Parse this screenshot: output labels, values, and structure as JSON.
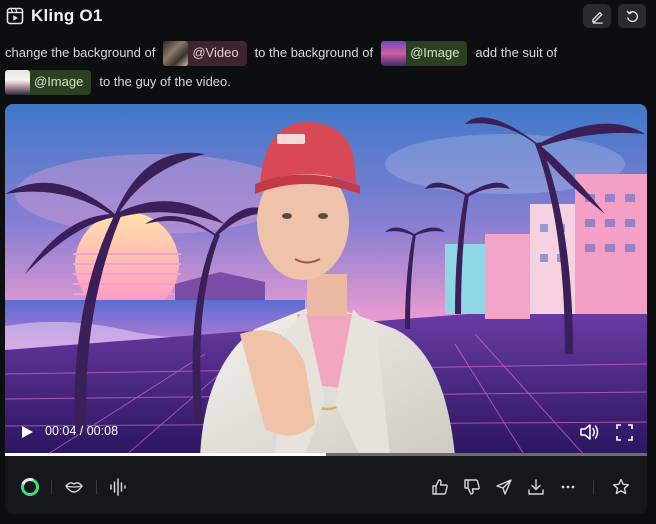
{
  "header": {
    "title": "Kling O1",
    "logo_icon": "film-icon",
    "edit_icon": "pencil-icon",
    "reset_icon": "undo-icon"
  },
  "prompt": {
    "text_1": "change the background of",
    "chip_video": "@Video",
    "text_2": "to the background of",
    "chip_image_1": "@Image",
    "text_3": "add the suit of",
    "chip_image_2": "@Image",
    "text_4": "to the guy of the video."
  },
  "player": {
    "current_time": "00:04",
    "separator": "/",
    "duration": "00:08",
    "progress": 0.5
  },
  "toolbar": {
    "icons": [
      "kling-logo-icon",
      "lips-icon",
      "audio-wave-icon",
      "thumbs-up-icon",
      "thumbs-down-icon",
      "send-icon",
      "download-icon",
      "more-icon",
      "star-icon"
    ]
  },
  "colors": {
    "background": "#0d0e10",
    "chip_video": "#3c2730",
    "chip_image": "#2c3f22",
    "accent_green": "#3ddc84"
  }
}
